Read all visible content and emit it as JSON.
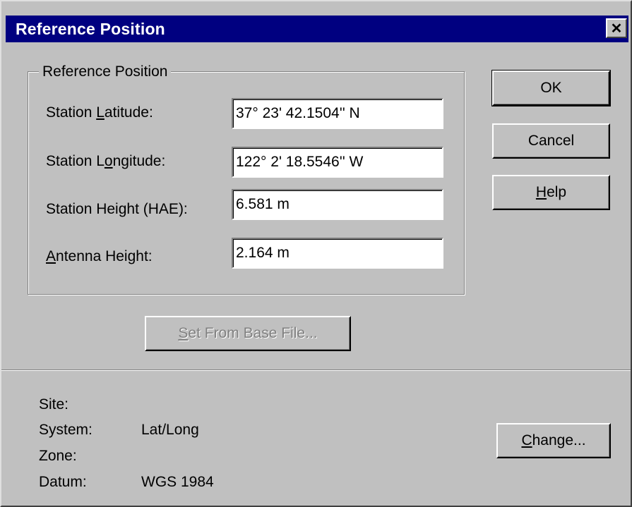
{
  "window": {
    "title": "Reference Position",
    "close_glyph": "✕"
  },
  "group": {
    "label": "Reference Position"
  },
  "fields": {
    "latitude": {
      "label_pre": "Station ",
      "label_key": "L",
      "label_post": "atitude:",
      "value": "37° 23' 42.1504'' N"
    },
    "longitude": {
      "label_pre": "Station L",
      "label_key": "o",
      "label_post": "ngitude:",
      "value": "122° 2' 18.5546'' W"
    },
    "height": {
      "label_pre": "Station Hei",
      "label_key": "g",
      "label_post": "ht (HAE):",
      "value": "6.581 m"
    },
    "antenna": {
      "label_pre": "",
      "label_key": "A",
      "label_post": "ntenna Height:",
      "value": "2.164 m"
    }
  },
  "buttons": {
    "ok": "OK",
    "cancel": "Cancel",
    "help_key": "H",
    "help_rest": "elp",
    "set_from_base_key": "S",
    "set_from_base_rest": "et From Base File...",
    "change_key": "C",
    "change_rest": "hange..."
  },
  "info": {
    "site_label": "Site:",
    "system_label": "System:",
    "system_value": "Lat/Long",
    "zone_label": "Zone:",
    "datum_label": "Datum:",
    "datum_value": "WGS 1984"
  }
}
